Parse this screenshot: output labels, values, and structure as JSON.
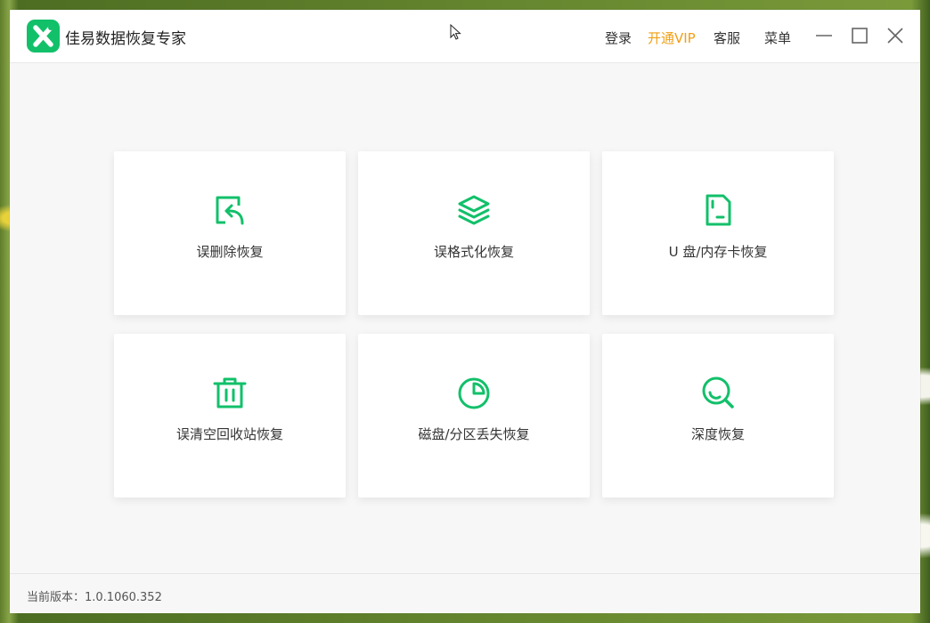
{
  "app": {
    "title": "佳易数据恢复专家"
  },
  "header": {
    "login": "登录",
    "vip": "开通VIP",
    "service": "客服",
    "menu": "菜单"
  },
  "colors": {
    "accent": "#12c06a",
    "vip": "#f0a016"
  },
  "cards": [
    {
      "label": "误删除恢复",
      "icon": "file-restore-icon"
    },
    {
      "label": "误格式化恢复",
      "icon": "layers-icon"
    },
    {
      "label": "U 盘/内存卡恢复",
      "icon": "sd-card-icon"
    },
    {
      "label": "误清空回收站恢复",
      "icon": "trash-icon"
    },
    {
      "label": "磁盘/分区丢失恢复",
      "icon": "pie-chart-icon"
    },
    {
      "label": "深度恢复",
      "icon": "magnifier-icon"
    }
  ],
  "footer": {
    "version": "当前版本：1.0.1060.352"
  }
}
